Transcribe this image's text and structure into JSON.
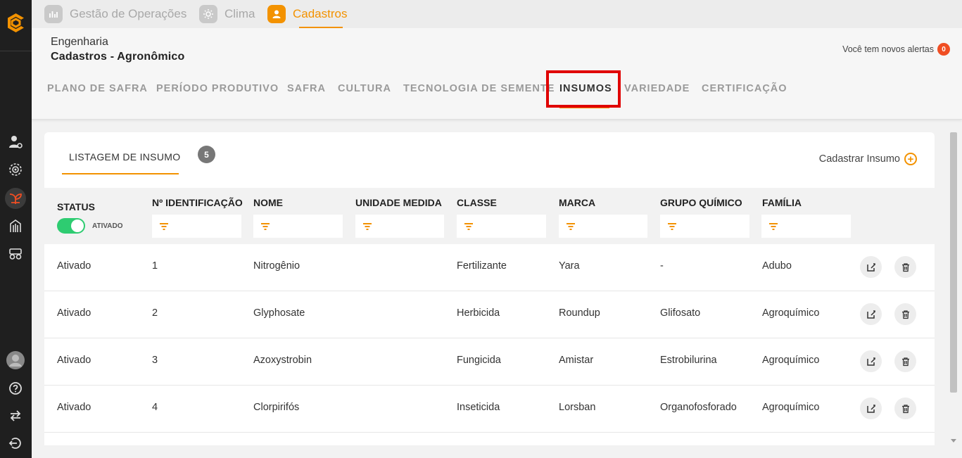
{
  "top_nav": {
    "tabs": [
      {
        "label": "Gestão de Operações",
        "icon": "chart-icon"
      },
      {
        "label": "Clima",
        "icon": "sun-icon"
      },
      {
        "label": "Cadastros",
        "icon": "user-icon",
        "active": true
      }
    ]
  },
  "header": {
    "breadcrumb": "Engenharia",
    "title": "Cadastros - Agronômico",
    "alerts_text": "Você tem novos alertas",
    "alerts_count": "0"
  },
  "sub_tabs": [
    {
      "label": "PLANO DE SAFRA"
    },
    {
      "label": "PERÍODO PRODUTIVO"
    },
    {
      "label": "SAFRA"
    },
    {
      "label": "CULTURA"
    },
    {
      "label": "TECNOLOGIA DE SEMENTE"
    },
    {
      "label": "INSUMOS",
      "active": true
    },
    {
      "label": "VARIEDADE"
    },
    {
      "label": "CERTIFICAÇÃO"
    }
  ],
  "card": {
    "tab_label": "LISTAGEM DE INSUMO",
    "count": "5",
    "register_label": "Cadastrar Insumo"
  },
  "table": {
    "columns": [
      "STATUS",
      "Nº IDENTIFICAÇÃO",
      "NOME",
      "UNIDADE MEDIDA",
      "CLASSE",
      "MARCA",
      "GRUPO QUÍMICO",
      "FAMÍLIA"
    ],
    "status_filter_label": "ATIVADO",
    "rows": [
      [
        "Ativado",
        "1",
        "Nitrogênio",
        "",
        "Fertilizante",
        "Yara",
        "-",
        "Adubo"
      ],
      [
        "Ativado",
        "2",
        "Glyphosate",
        "",
        "Herbicida",
        "Roundup",
        "Glifosato",
        "Agroquímico"
      ],
      [
        "Ativado",
        "3",
        "Azoxystrobin",
        "",
        "Fungicida",
        "Amistar",
        "Estrobilurina",
        "Agroquímico"
      ],
      [
        "Ativado",
        "4",
        "Clorpirifós",
        "",
        "Inseticida",
        "Lorsban",
        "Organofosforado",
        "Agroquímico"
      ]
    ]
  },
  "colors": {
    "accent": "#f39200",
    "sidebar": "#1f1f1f",
    "toggle_on": "#2ecc71",
    "alert_badge": "#f04e23",
    "highlight": "#e00000"
  }
}
